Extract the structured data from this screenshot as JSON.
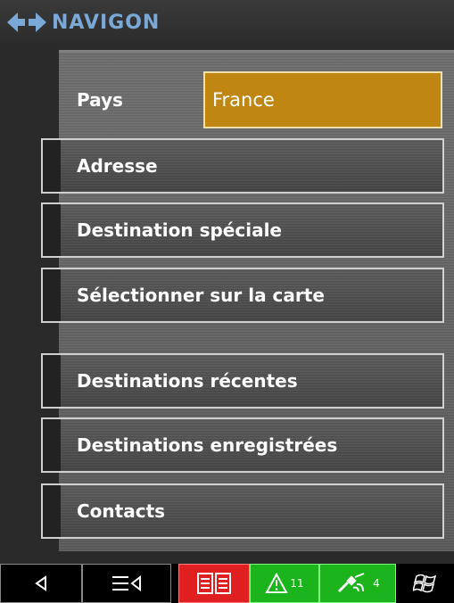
{
  "header": {
    "brand": "NAVIGON",
    "logo_icon": "navigon-arrows-icon"
  },
  "country": {
    "label": "Pays",
    "value": "France"
  },
  "menu": {
    "items": [
      {
        "label": "Adresse"
      },
      {
        "label": "Destination spéciale"
      },
      {
        "label": "Sélectionner sur la carte"
      },
      {
        "label": "Destinations récentes"
      },
      {
        "label": "Destinations enregistrées"
      },
      {
        "label": "Contacts"
      }
    ]
  },
  "toolbar": {
    "back_icon": "back-arrow-icon",
    "menu_icon": "list-menu-icon",
    "book_icon": "book-icon",
    "warning_icon": "warning-icon",
    "warning_count": "11",
    "gps_icon": "satellite-icon",
    "gps_count": "4",
    "windows_icon": "windows-flag-icon"
  },
  "colors": {
    "country_field": "#c08612",
    "book_button": "#e02020",
    "status_green": "#1cb41c",
    "brand_blue": "#7aa9d8"
  }
}
